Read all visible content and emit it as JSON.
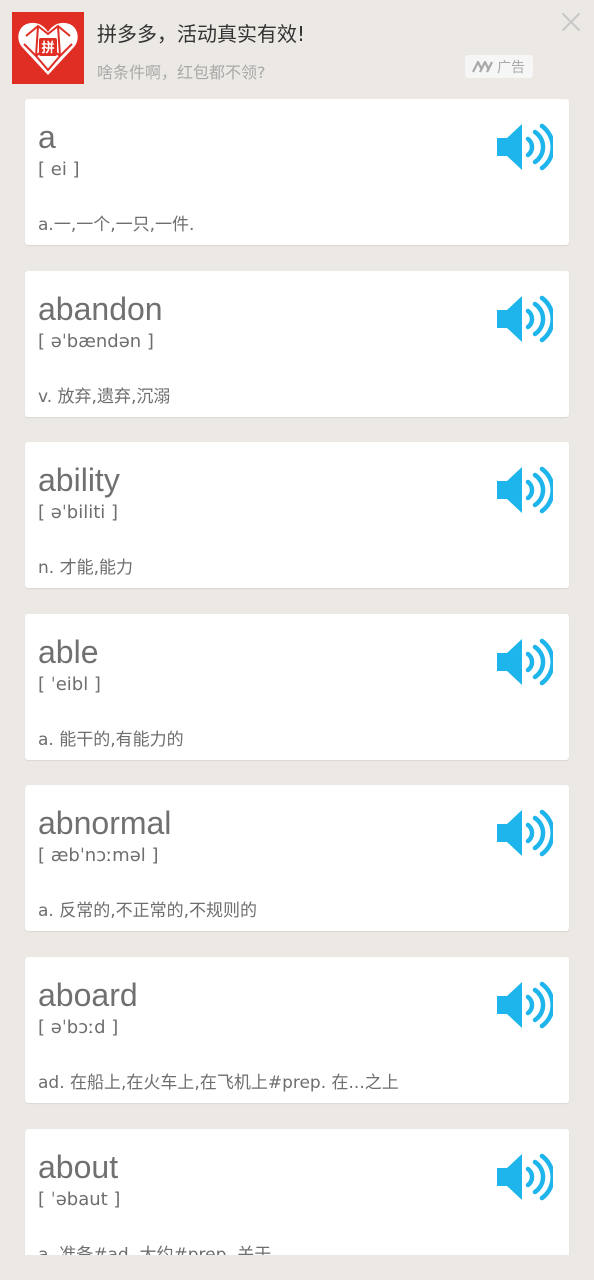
{
  "ad": {
    "title": "拼多多，活动真实有效!",
    "subtitle": "啥条件啊，红包都不领?",
    "tag": "广告",
    "logo_icon": "pinduoduo-logo-icon",
    "close_icon": "close-icon",
    "brand_color": "#e02e24"
  },
  "speaker_color": "#1eb4ec",
  "words": [
    {
      "word": "a",
      "phonetic": "[ ei ]",
      "definition": "a.一,一个,一只,一件."
    },
    {
      "word": "abandon",
      "phonetic": "[ əˈbændən ]",
      "definition": "v. 放弃,遗弃,沉溺"
    },
    {
      "word": "ability",
      "phonetic": "[ əˈbiliti ]",
      "definition": "n. 才能,能力"
    },
    {
      "word": "able",
      "phonetic": "[ ˈeibl ]",
      "definition": "a. 能干的,有能力的"
    },
    {
      "word": "abnormal",
      "phonetic": "[ æbˈnɔːməl ]",
      "definition": "a. 反常的,不正常的,不规则的"
    },
    {
      "word": "aboard",
      "phonetic": "[ əˈbɔːd ]",
      "definition": "ad. 在船上,在火车上,在飞机上#prep. 在...之上"
    },
    {
      "word": "about",
      "phonetic": "[ ˈəbaut ]",
      "definition": "a. 准备#ad. 大约#prep. 关于"
    }
  ]
}
